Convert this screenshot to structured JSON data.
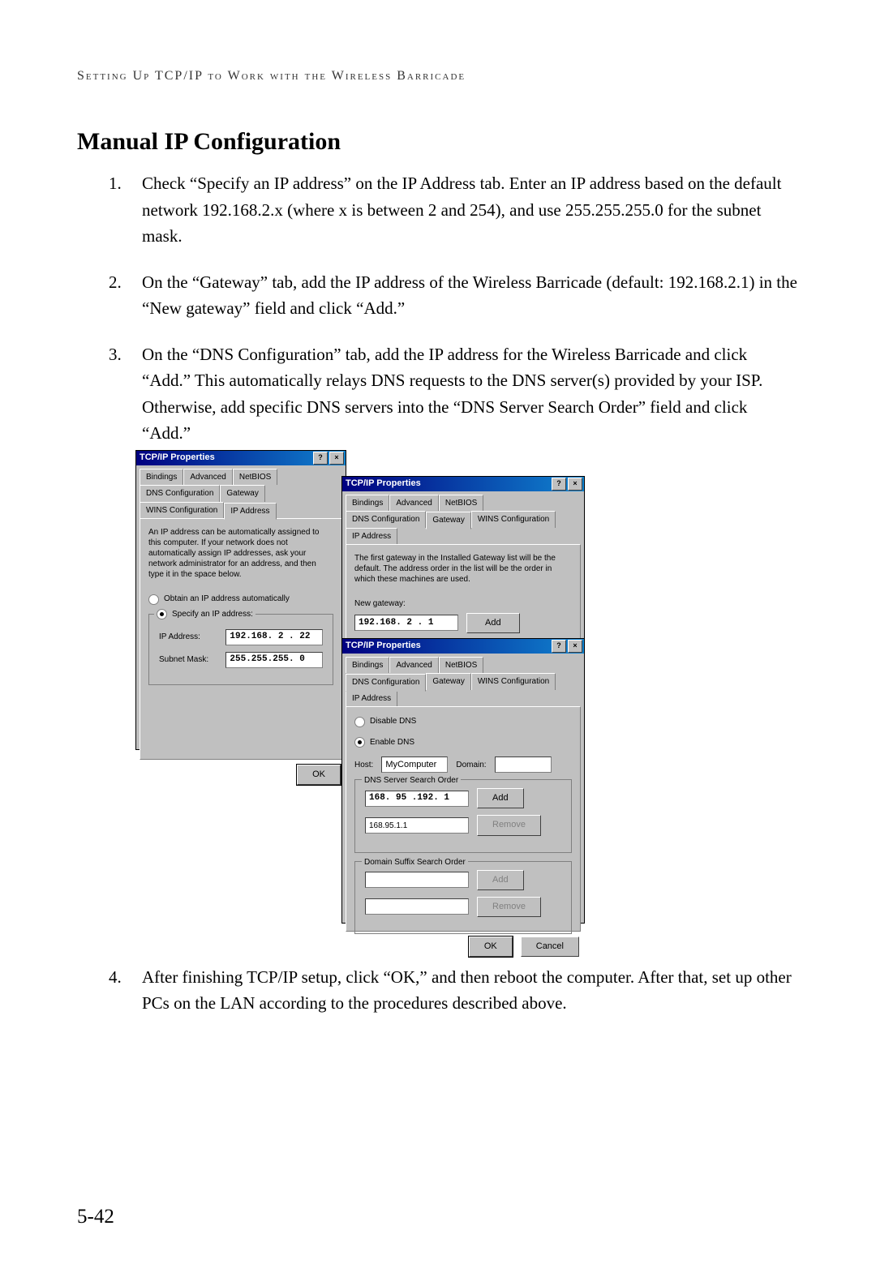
{
  "runningHead": "Setting Up TCP/IP to Work with the Wireless Barricade",
  "heading": "Manual IP Configuration",
  "steps": [
    "Check “Specify an IP address” on the IP Address tab. Enter an IP address based on the default network 192.168.2.x (where x is between 2 and 254), and use 255.255.255.0 for the subnet mask.",
    "On the “Gateway” tab, add the IP address of the Wireless Barricade (default: 192.168.2.1) in the “New gateway” field and click “Add.”",
    "On the “DNS Configuration” tab, add the IP address for the Wireless Barricade and click “Add.” This automatically relays DNS requests to the DNS server(s) provided by your ISP. Otherwise, add specific DNS servers into the “DNS Server Search Order” field and click “Add.”",
    "After finishing TCP/IP setup, click “OK,” and then reboot the computer. After that, set up other PCs on the LAN according to the procedures described above."
  ],
  "pageNum": "5-42",
  "dlgTitle": "TCP/IP Properties",
  "helpGlyph": "?",
  "closeGlyph": "×",
  "tabsRow1": [
    "Bindings",
    "Advanced",
    "NetBIOS"
  ],
  "tabsRow2": [
    "DNS Configuration",
    "Gateway",
    "WINS Configuration",
    "IP Address"
  ],
  "ipInfo": "An IP address can be automatically assigned to this computer. If your network does not automatically assign IP addresses, ask your network administrator for an address, and then type it in the space below.",
  "radioAuto": "Obtain an IP address automatically",
  "radioSpec": "Specify an IP address:",
  "lblIp": "IP Address:",
  "valIp": "192.168. 2 . 22",
  "lblMask": "Subnet Mask:",
  "valMask": "255.255.255. 0",
  "btnOk": "OK",
  "btnCancel": "Cancel",
  "gwInfo": "The first gateway in the Installed Gateway list will be the default. The address order in the list will be the order in which these machines are used.",
  "lblNewGw": "New gateway:",
  "valNewGw": "192.168. 2 . 1",
  "btnAdd": "Add",
  "dnsDisable": "Disable DNS",
  "dnsEnable": "Enable DNS",
  "lblHost": "Host:",
  "valHost": "MyComputer",
  "lblDomain": "Domain:",
  "grpDnsOrder": "DNS Server Search Order",
  "valDnsNew": "168. 95 .192. 1",
  "valDnsExisting": "168.95.1.1",
  "btnRemove": "Remove",
  "grpSuffix": "Domain Suffix Search Order"
}
